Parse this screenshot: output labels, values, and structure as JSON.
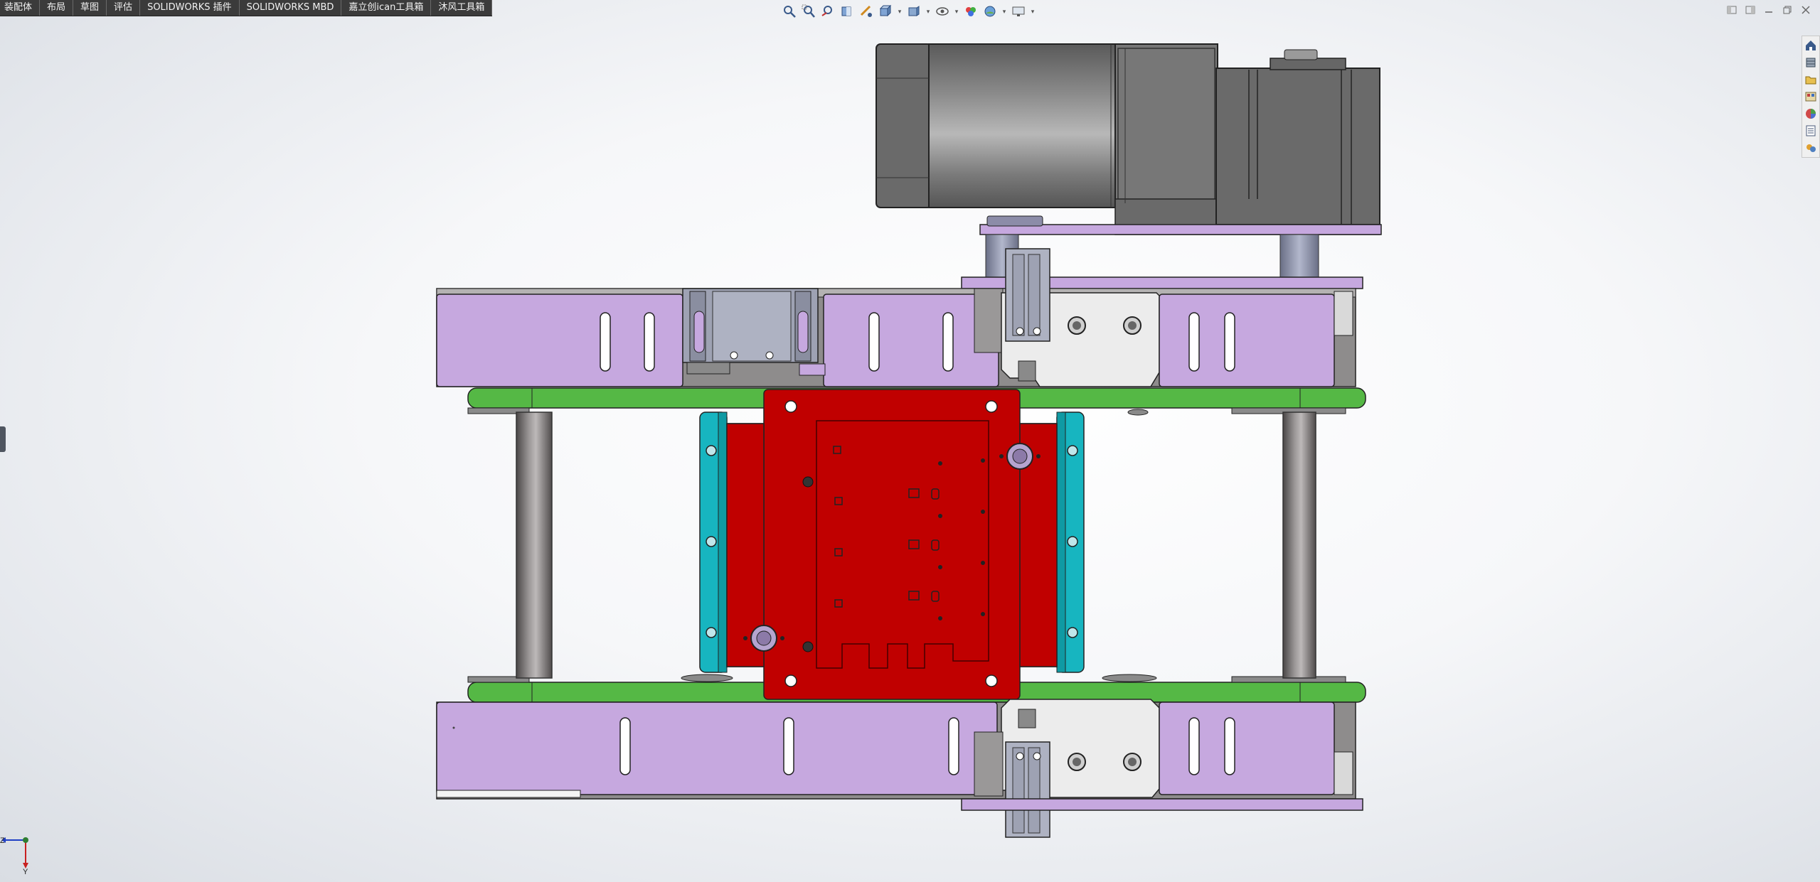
{
  "app": {
    "name": "SOLIDWORKS"
  },
  "tabs": [
    {
      "label": "装配体"
    },
    {
      "label": "布局"
    },
    {
      "label": "草图"
    },
    {
      "label": "评估"
    },
    {
      "label": "SOLIDWORKS 插件"
    },
    {
      "label": "SOLIDWORKS MBD"
    },
    {
      "label": "嘉立创ican工具箱"
    },
    {
      "label": "沐风工具箱"
    }
  ],
  "heads_up_toolbar": [
    {
      "icon": "zoom-to-fit-icon"
    },
    {
      "icon": "zoom-to-area-icon"
    },
    {
      "icon": "previous-view-icon"
    },
    {
      "icon": "section-view-icon"
    },
    {
      "icon": "dynamic-annotation-icon"
    },
    {
      "icon": "view-orientation-icon"
    },
    {
      "icon": "display-style-icon"
    },
    {
      "icon": "hide-show-items-icon"
    },
    {
      "icon": "edit-appearance-icon"
    },
    {
      "icon": "apply-scene-icon"
    },
    {
      "icon": "view-settings-icon"
    }
  ],
  "window_controls": [
    {
      "icon": "tile-left-icon"
    },
    {
      "icon": "tile-right-icon"
    },
    {
      "icon": "minimize-icon"
    },
    {
      "icon": "restore-icon"
    },
    {
      "icon": "close-icon"
    }
  ],
  "task_pane": [
    {
      "icon": "solidworks-resources-icon"
    },
    {
      "icon": "design-library-icon"
    },
    {
      "icon": "file-explorer-icon"
    },
    {
      "icon": "view-palette-icon"
    },
    {
      "icon": "appearances-scenes-icon"
    },
    {
      "icon": "custom-properties-icon"
    },
    {
      "icon": "solidworks-forum-icon"
    }
  ],
  "triad": {
    "axis_z": "Z",
    "axis_y": "Y"
  },
  "colors": {
    "plate_purple": "#c6a8df",
    "rail_green": "#55b845",
    "red_plate": "#c00000",
    "cyan_strip": "#17b5c0",
    "motor_grey": "#6d6d6d",
    "bracket_grey": "#eeeeee"
  }
}
